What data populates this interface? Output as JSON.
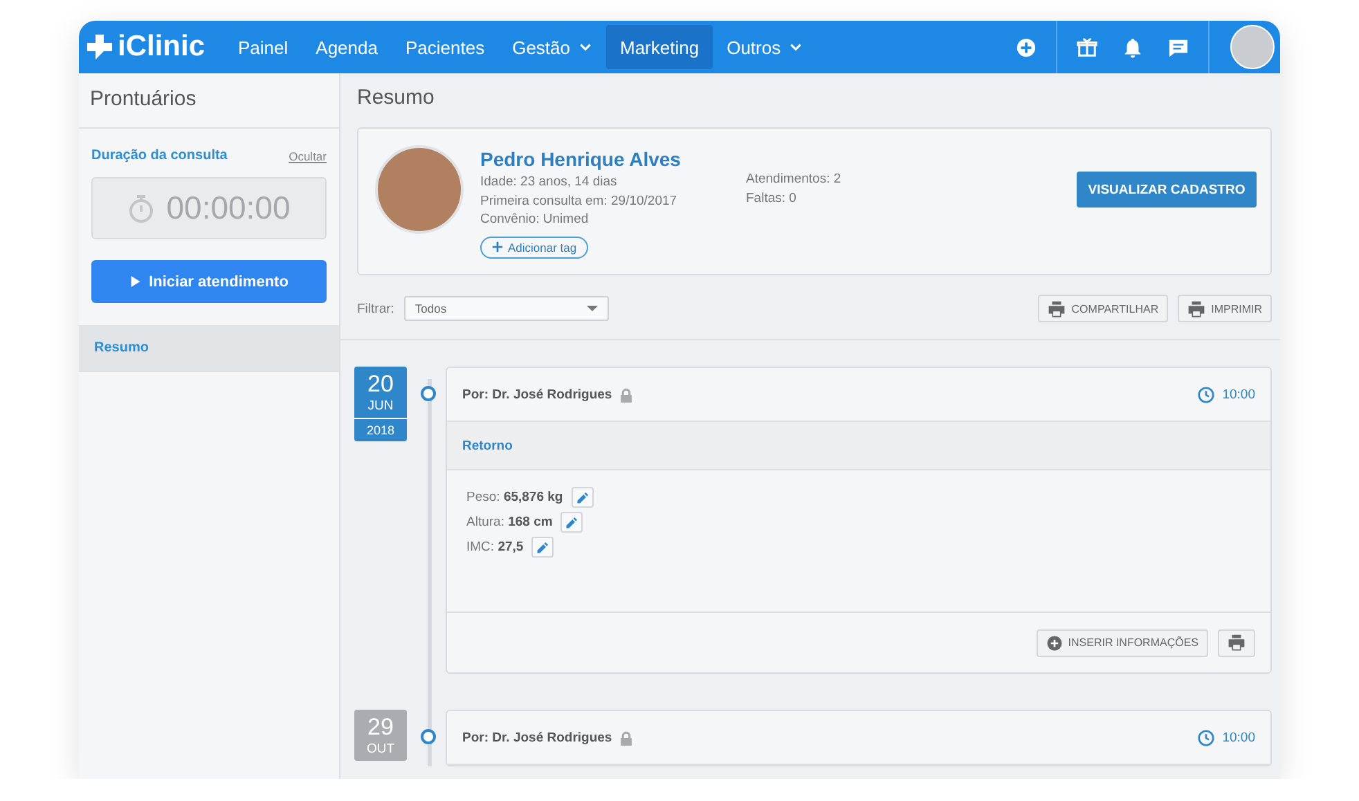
{
  "navbar": {
    "logo": "iClinic",
    "items": [
      {
        "label": "Painel",
        "selected": false,
        "dropdown": false
      },
      {
        "label": "Agenda",
        "selected": false,
        "dropdown": false
      },
      {
        "label": "Pacientes",
        "selected": false,
        "dropdown": false
      },
      {
        "label": "Gestão",
        "selected": false,
        "dropdown": true
      },
      {
        "label": "Marketing",
        "selected": true,
        "dropdown": false
      },
      {
        "label": "Outros",
        "selected": false,
        "dropdown": true
      }
    ]
  },
  "sidebar": {
    "title": "Prontuários",
    "timer_label": "Duração da consulta",
    "hide_link": "Ocultar",
    "timer": "00:00:00",
    "start_button": "Iniciar atendimento",
    "items": [
      {
        "label": "Resumo",
        "selected": true
      }
    ]
  },
  "main": {
    "title": "Resumo",
    "patient": {
      "name": "Pedro Henrique Alves",
      "details": [
        "Idade: 23 anos, 14 dias",
        "Primeira consulta em: 29/10/2017",
        "Convênio: Unimed"
      ],
      "stats": [
        "Atendimentos: 2",
        "Faltas: 0"
      ],
      "add_tag": "Adicionar tag",
      "view_button": "VISUALIZAR CADASTRO"
    },
    "filter": {
      "label": "Filtrar:",
      "value": "Todos"
    },
    "share_button": "COMPARTILHAR",
    "print_button": "IMPRIMIR",
    "entries": [
      {
        "day": "20",
        "month": "JUN",
        "year": "2018",
        "active": true,
        "author": "Por: Dr. José Rodrigues",
        "locked": true,
        "time": "10:00",
        "type": "Retorno",
        "fields": [
          {
            "label": "Peso:",
            "value": "65,876 kg"
          },
          {
            "label": "Altura:",
            "value": "168 cm"
          },
          {
            "label": "IMC:",
            "value": "27,5"
          }
        ],
        "insert_button": "INSERIR INFORMAÇÕES"
      },
      {
        "day": "29",
        "month": "OUT",
        "active": false,
        "author": "Por: Dr. José Rodrigues",
        "locked": true,
        "time": "10:00"
      }
    ]
  }
}
